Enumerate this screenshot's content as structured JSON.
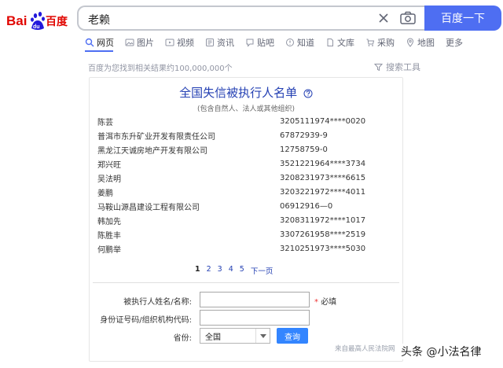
{
  "logo": {
    "text_left": "Bai",
    "text_right": "百度",
    "paw_text": "du"
  },
  "search": {
    "query": "老赖",
    "button_label": "百度一下"
  },
  "tabs": [
    {
      "label": "网页",
      "icon": "search-icon"
    },
    {
      "label": "图片",
      "icon": "image-icon"
    },
    {
      "label": "视频",
      "icon": "video-icon"
    },
    {
      "label": "资讯",
      "icon": "news-icon"
    },
    {
      "label": "贴吧",
      "icon": "tieba-icon"
    },
    {
      "label": "知道",
      "icon": "zhidao-icon"
    },
    {
      "label": "文库",
      "icon": "wenku-icon"
    },
    {
      "label": "采购",
      "icon": "purchase-icon"
    },
    {
      "label": "地图",
      "icon": "map-icon"
    },
    {
      "label": "更多",
      "icon": ""
    }
  ],
  "result_count": "百度为您找到相关结果约100,000,000个",
  "search_tools": "搜索工具",
  "card": {
    "title": "全国失信被执行人名单",
    "subtitle": "(包含自然人、法人或其他组织)",
    "rows": [
      {
        "name": "陈芸",
        "id": "3205111974****0020"
      },
      {
        "name": "普洱市东升矿业开发有限责任公司",
        "id": "67872939-9"
      },
      {
        "name": "黑龙江天诚房地产开发有限公司",
        "id": "12758759-0"
      },
      {
        "name": "郑兴旺",
        "id": "3521221964****3734"
      },
      {
        "name": "吴法明",
        "id": "3208231973****6615"
      },
      {
        "name": "姜鹏",
        "id": "3203221972****4011"
      },
      {
        "name": "马鞍山源昌建设工程有限公司",
        "id": "06912916—0"
      },
      {
        "name": "韩加先",
        "id": "3208311972****1017"
      },
      {
        "name": "陈胜丰",
        "id": "3307261958****2519"
      },
      {
        "name": "何鹏举",
        "id": "3210251973****5030"
      }
    ],
    "pager": {
      "pages": [
        "1",
        "2",
        "3",
        "4",
        "5"
      ],
      "next": "下一页",
      "current": "1"
    },
    "form": {
      "name_label": "被执行人姓名/名称:",
      "required_star": "*",
      "required_text": "必填",
      "id_label": "身份证号码/组织机构代码:",
      "province_label": "省份:",
      "province_value": "全国",
      "query_button": "查询"
    },
    "source": "来自最高人民法院网"
  },
  "watermark": "头条 @小法名律",
  "colors": {
    "brand_blue": "#4e6ef2",
    "link_blue": "#2440b3",
    "logo_red": "#e10601",
    "logo_blue": "#2319dc"
  }
}
